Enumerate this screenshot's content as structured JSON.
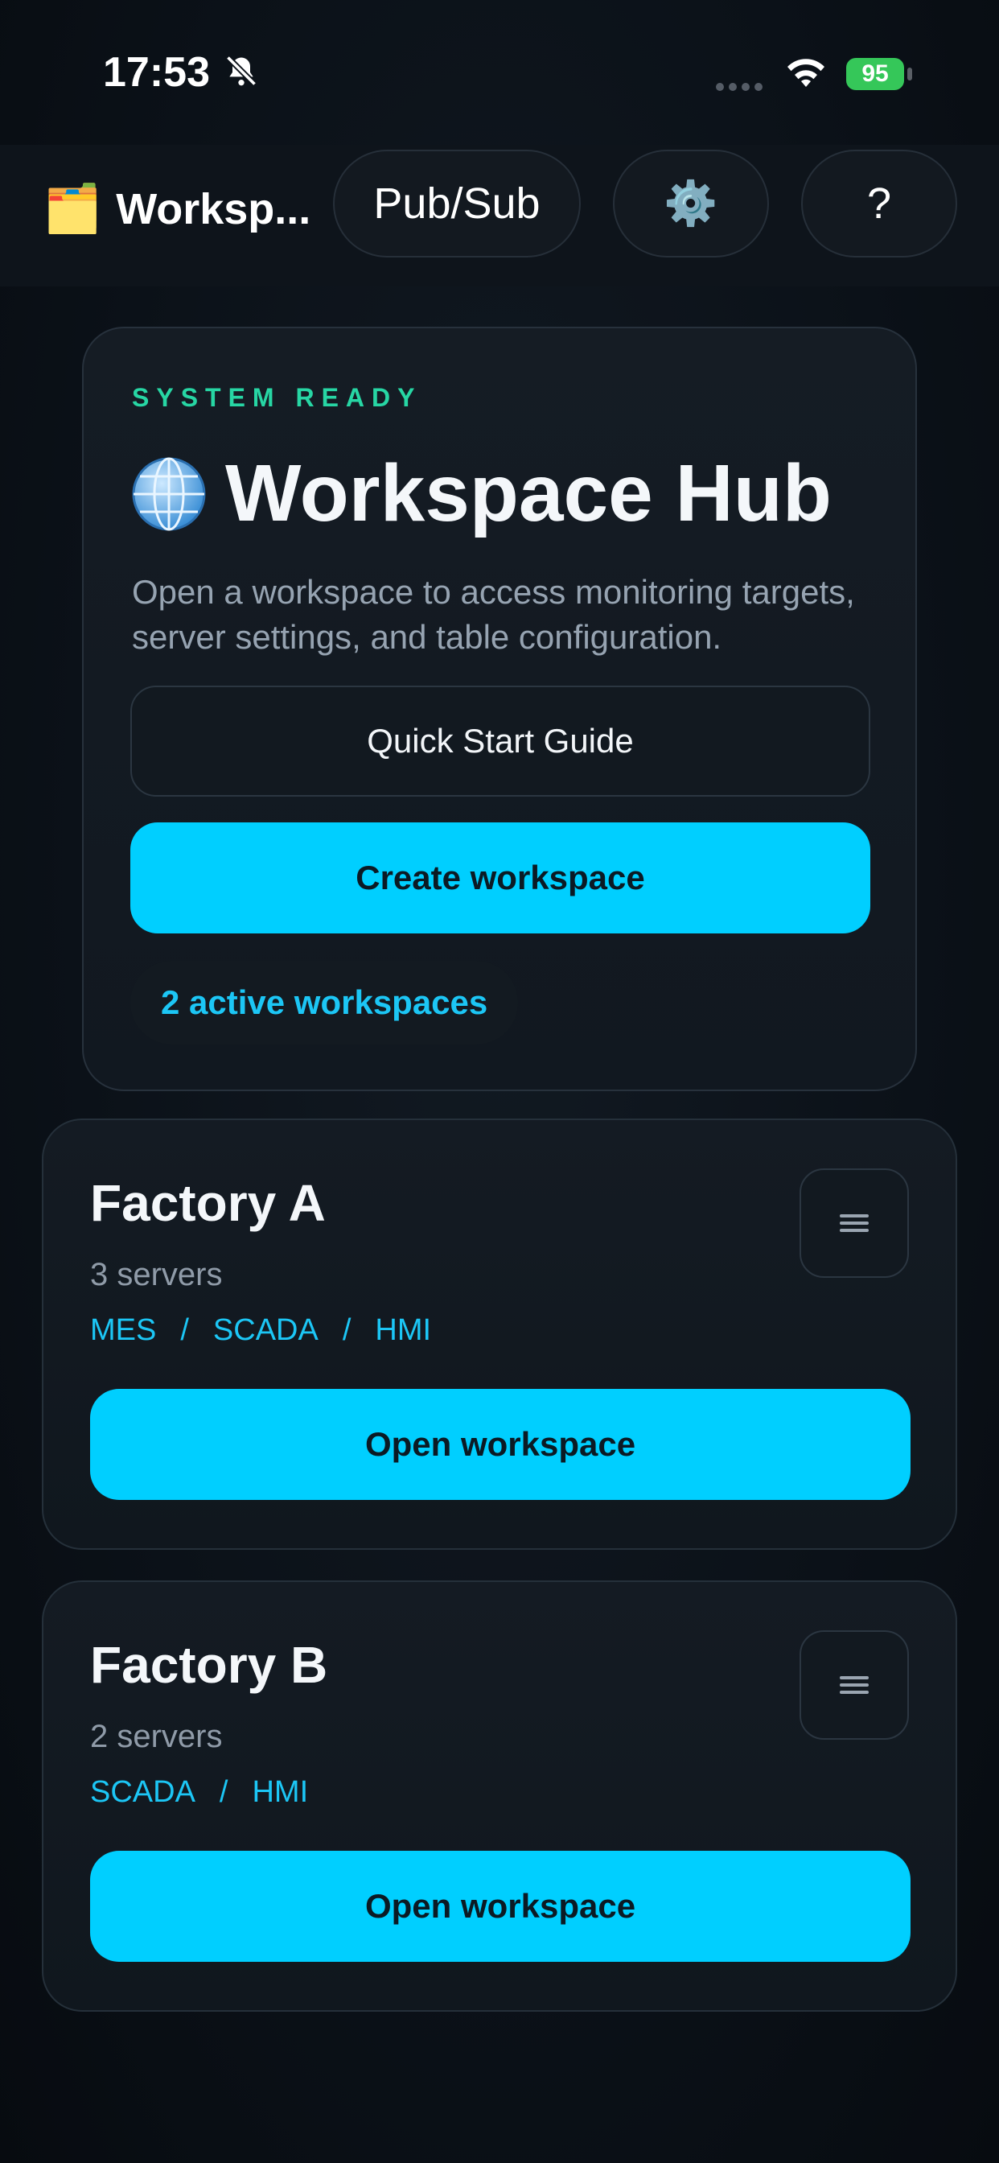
{
  "status_bar": {
    "time": "17:53",
    "battery": "95"
  },
  "header": {
    "app_title": "Worksp...",
    "app_emoji": "🗂️",
    "pubsub_label": "Pub/Sub",
    "settings_icon": "⚙️",
    "help_label": "?"
  },
  "hero": {
    "eyebrow": "SYSTEM READY",
    "title": "Workspace Hub",
    "description": "Open a workspace to access monitoring targets, server settings, and table configuration.",
    "guide_label": "Quick Start Guide",
    "create_label": "Create workspace",
    "active_label": "2 active workspaces"
  },
  "workspaces": [
    {
      "name": "Factory A",
      "servers": "3 servers",
      "tags": [
        "MES",
        "SCADA",
        "HMI"
      ],
      "open_label": "Open workspace"
    },
    {
      "name": "Factory B",
      "servers": "2 servers",
      "tags": [
        "SCADA",
        "HMI"
      ],
      "open_label": "Open workspace"
    }
  ],
  "colors": {
    "accent": "#00cfff",
    "ready": "#27d6a4",
    "link": "#1cc6f5"
  }
}
